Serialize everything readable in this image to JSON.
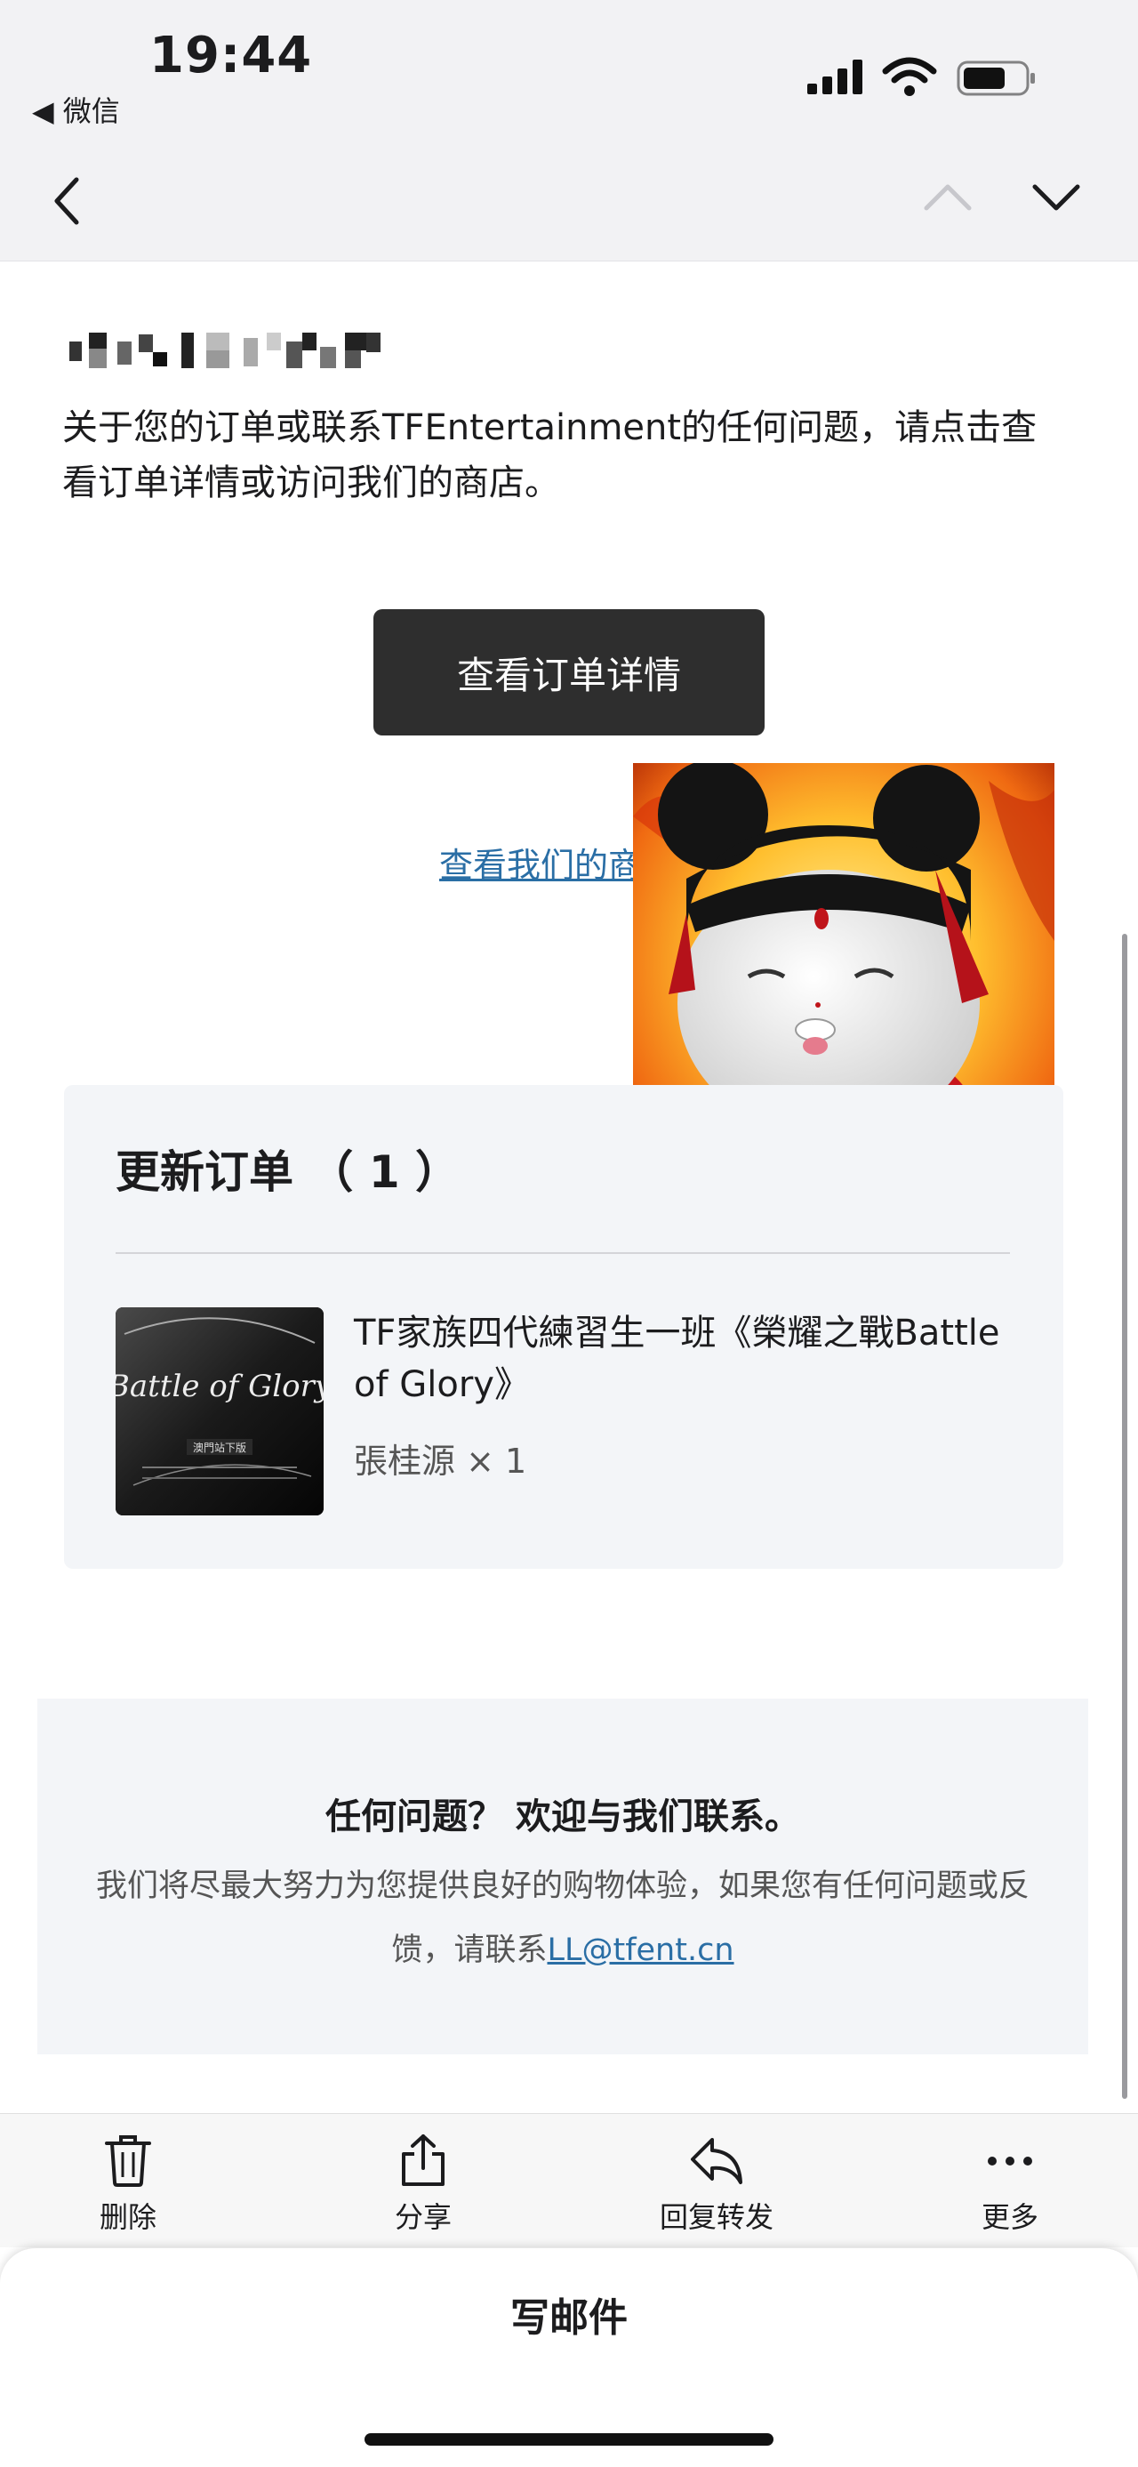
{
  "status_bar": {
    "time": "19:44",
    "back_app": "◀ 微信",
    "icons": [
      "signal-icon",
      "wifi-icon",
      "battery-icon"
    ]
  },
  "nav": {
    "icons": [
      "chevron-left-icon",
      "chevron-up-icon",
      "chevron-down-icon"
    ]
  },
  "email": {
    "intro": "关于您的订单或联系TFEntertainment的任何问题，请点击查看订单详情或访问我们的商店。",
    "view_order_button": "查看订单详情",
    "store_link": "查看我们的商店"
  },
  "order": {
    "title": "更新订单 （ 1 ）",
    "product": {
      "name": "TF家族四代練習生一班《榮耀之戰Battle of Glory》",
      "variant": "張桂源 × 1",
      "thumb_title": "Battle of Glory",
      "thumb_subtitle": "澳門站下版"
    }
  },
  "contact": {
    "title": "任何问题？ 欢迎与我们联系。",
    "body": "我们将尽最大努力为您提供良好的购物体验，如果您有任何问题或反馈，请联系",
    "email": "LL@tfent.cn"
  },
  "toolbar": {
    "items": [
      {
        "label": "删除",
        "icon": "trash-icon"
      },
      {
        "label": "分享",
        "icon": "share-icon"
      },
      {
        "label": "回复转发",
        "icon": "reply-icon"
      },
      {
        "label": "更多",
        "icon": "more-icon"
      }
    ]
  },
  "compose": {
    "label": "写邮件"
  },
  "colors": {
    "button_bg": "#2e2e2e",
    "link": "#2a6ea5",
    "card_bg": "#f3f5f8",
    "header_bg": "#f2f2f4"
  }
}
